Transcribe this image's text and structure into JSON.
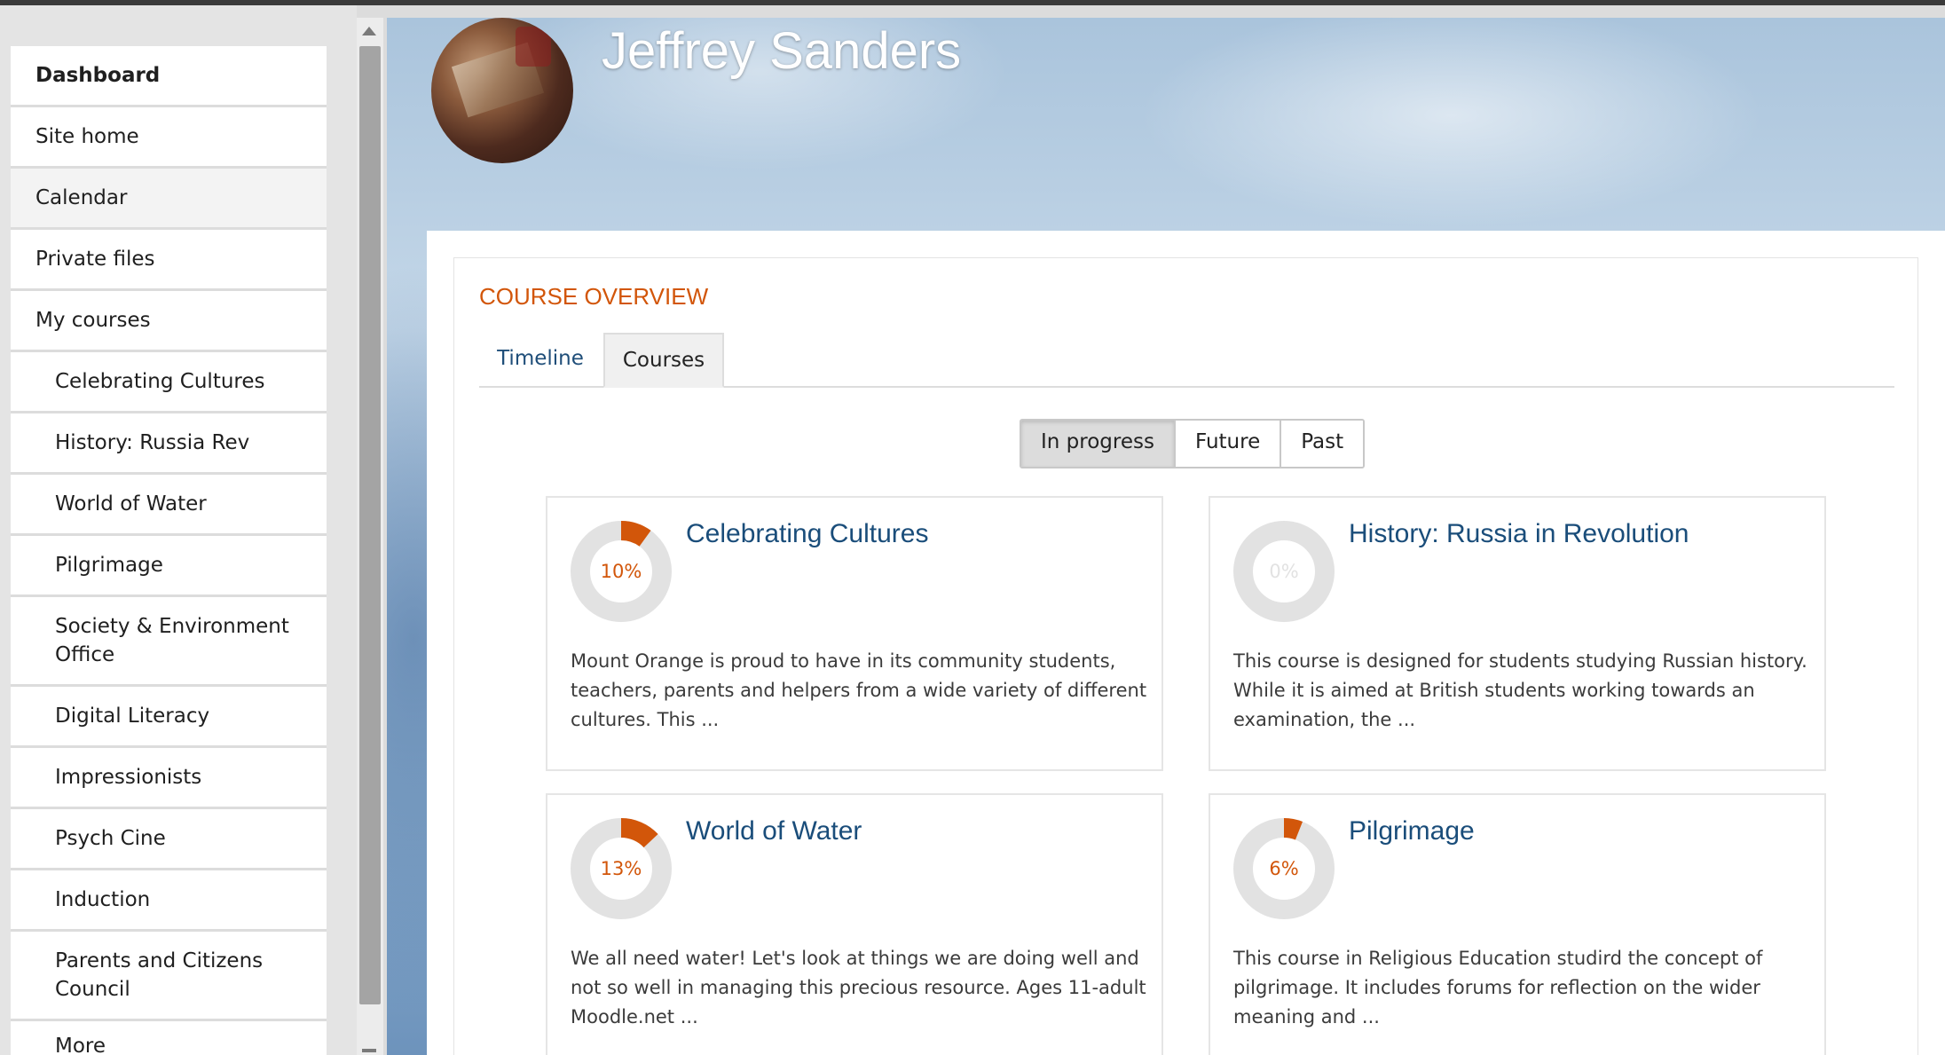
{
  "sidebar": {
    "items": [
      {
        "label": "Dashboard"
      },
      {
        "label": "Site home"
      },
      {
        "label": "Calendar"
      },
      {
        "label": "Private files"
      },
      {
        "label": "My courses"
      },
      {
        "label": "Celebrating Cultures"
      },
      {
        "label": "History: Russia Rev"
      },
      {
        "label": "World of Water"
      },
      {
        "label": "Pilgrimage"
      },
      {
        "label": "Society & Environment Office"
      },
      {
        "label": "Digital Literacy"
      },
      {
        "label": "Impressionists"
      },
      {
        "label": "Psych Cine"
      },
      {
        "label": "Induction"
      },
      {
        "label": "Parents and Citizens Council"
      },
      {
        "label": "More"
      }
    ]
  },
  "header": {
    "user_name": "Jeffrey Sanders"
  },
  "overview": {
    "title": "COURSE OVERVIEW",
    "tabs": [
      {
        "label": "Timeline"
      },
      {
        "label": "Courses"
      }
    ],
    "filters": [
      {
        "label": "In progress"
      },
      {
        "label": "Future"
      },
      {
        "label": "Past"
      }
    ],
    "active_filter": "In progress",
    "active_tab": "Courses"
  },
  "courses": [
    {
      "title": "Celebrating Cultures",
      "progress": 10,
      "progress_label": "10%",
      "summary": "Mount Orange is proud to have in its community students, teachers, parents and helpers from a wide variety of different cultures. This ..."
    },
    {
      "title": "History: Russia in Revolution",
      "progress": 0,
      "progress_label": "0%",
      "summary": "This course is designed for students studying Russian history. While it is aimed at British students working towards an examination, the ..."
    },
    {
      "title": "World of Water",
      "progress": 13,
      "progress_label": "13%",
      "summary": "We all need water! Let's look at things we are doing well and not so well in managing this precious resource. Ages 11-adult Moodle.net ..."
    },
    {
      "title": "Pilgrimage",
      "progress": 6,
      "progress_label": "6%",
      "summary": "This course in  Religious Education studird the concept of pilgrimage. It includes forums for reflection on the wider meaning and ..."
    }
  ],
  "colors": {
    "accent": "#d2560a",
    "link": "#1a4d7a",
    "ring_track": "#e2e2e2"
  }
}
